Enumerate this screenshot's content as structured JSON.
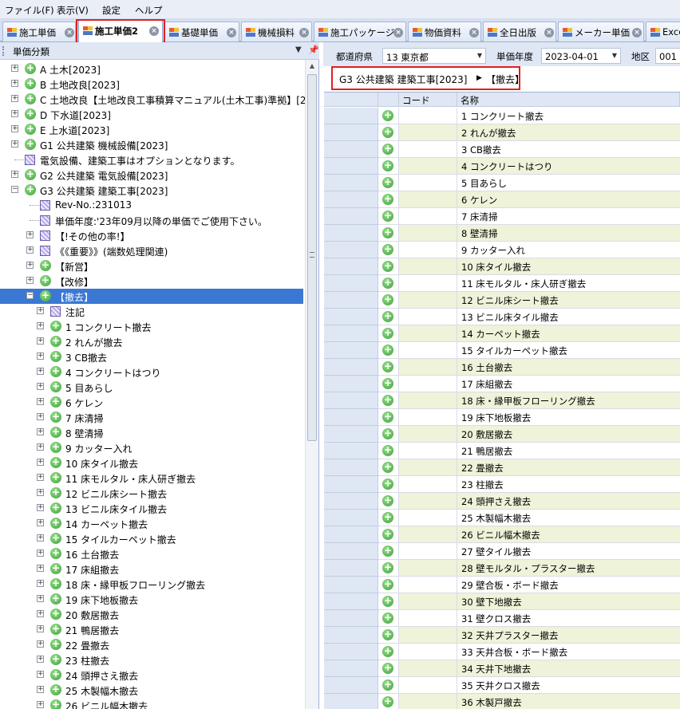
{
  "menubar": {
    "items": [
      "ファイル(F)",
      "表示(V)",
      "設定",
      "ヘルプ"
    ]
  },
  "tabs": [
    {
      "label": "施工単価",
      "active": false
    },
    {
      "label": "施工単価2",
      "active": true
    },
    {
      "label": "基礎単価",
      "active": false
    },
    {
      "label": "機械損料",
      "active": false
    },
    {
      "label": "施工パッケージ",
      "active": false
    },
    {
      "label": "物価資料",
      "active": false
    },
    {
      "label": "全日出版",
      "active": false
    },
    {
      "label": "メーカー単価",
      "active": false
    },
    {
      "label": "Exce",
      "active": false
    }
  ],
  "left_panel": {
    "title": "単価分類",
    "menu_glyph": "▼",
    "pin_glyph": "ㅁ",
    "tree": [
      {
        "label": "A 土木[2023]",
        "icon": "plus-circle-icon",
        "level": 0,
        "expander": "+"
      },
      {
        "label": "B 土地改良[2023]",
        "icon": "plus-circle-icon",
        "level": 0,
        "expander": "+"
      },
      {
        "label": "C 土地改良【土地改良工事積算マニュアル(土木工事)準拠】[2",
        "icon": "plus-circle-icon",
        "level": 0,
        "expander": "+"
      },
      {
        "label": "D 下水道[2023]",
        "icon": "plus-circle-icon",
        "level": 0,
        "expander": "+"
      },
      {
        "label": "E 上水道[2023]",
        "icon": "plus-circle-icon",
        "level": 0,
        "expander": "+"
      },
      {
        "label": "G1 公共建築 機械設備[2023]",
        "icon": "plus-circle-icon",
        "level": 0,
        "expander": "+"
      },
      {
        "label": "電気設備、建築工事はオプションとなります。",
        "icon": "note-icon",
        "level": 0,
        "expander": ""
      },
      {
        "label": "G2 公共建築 電気設備[2023]",
        "icon": "plus-circle-icon",
        "level": 0,
        "expander": "+"
      },
      {
        "label": "G3 公共建築 建築工事[2023]",
        "icon": "plus-circle-icon",
        "level": 0,
        "expander": "−"
      },
      {
        "label": "Rev-No.:231013",
        "icon": "note-icon",
        "level": 1,
        "expander": ""
      },
      {
        "label": "単価年度:'23年09月以降の単価でご使用下さい。",
        "icon": "note-icon",
        "level": 1,
        "expander": ""
      },
      {
        "label": "【!その他の率!】",
        "icon": "note-icon",
        "level": 1,
        "expander": "+"
      },
      {
        "label": "《《重要》》(端数処理関連)",
        "icon": "note-icon",
        "level": 1,
        "expander": "+"
      },
      {
        "label": "【新営】",
        "icon": "plus-circle-icon",
        "level": 1,
        "expander": "+"
      },
      {
        "label": "【改修】",
        "icon": "plus-circle-icon",
        "level": 1,
        "expander": "+"
      },
      {
        "label": "【撤去】",
        "icon": "plus-circle-icon",
        "level": 1,
        "expander": "−",
        "selected": true
      },
      {
        "label": "注記",
        "icon": "note-icon",
        "level": 2,
        "expander": "+"
      },
      {
        "label": "1 コンクリート撤去",
        "icon": "plus-circle-icon",
        "level": 2,
        "expander": "+"
      },
      {
        "label": "2 れんが撤去",
        "icon": "plus-circle-icon",
        "level": 2,
        "expander": "+"
      },
      {
        "label": "3 CB撤去",
        "icon": "plus-circle-icon",
        "level": 2,
        "expander": "+"
      },
      {
        "label": "4 コンクリートはつり",
        "icon": "plus-circle-icon",
        "level": 2,
        "expander": "+"
      },
      {
        "label": "5 目あらし",
        "icon": "plus-circle-icon",
        "level": 2,
        "expander": "+"
      },
      {
        "label": "6 ケレン",
        "icon": "plus-circle-icon",
        "level": 2,
        "expander": "+"
      },
      {
        "label": "7 床清掃",
        "icon": "plus-circle-icon",
        "level": 2,
        "expander": "+"
      },
      {
        "label": "8 壁清掃",
        "icon": "plus-circle-icon",
        "level": 2,
        "expander": "+"
      },
      {
        "label": "9 カッター入れ",
        "icon": "plus-circle-icon",
        "level": 2,
        "expander": "+"
      },
      {
        "label": "10 床タイル撤去",
        "icon": "plus-circle-icon",
        "level": 2,
        "expander": "+"
      },
      {
        "label": "11 床モルタル・床人研ぎ撤去",
        "icon": "plus-circle-icon",
        "level": 2,
        "expander": "+"
      },
      {
        "label": "12 ビニル床シート撤去",
        "icon": "plus-circle-icon",
        "level": 2,
        "expander": "+"
      },
      {
        "label": "13 ビニル床タイル撤去",
        "icon": "plus-circle-icon",
        "level": 2,
        "expander": "+"
      },
      {
        "label": "14 カーペット撤去",
        "icon": "plus-circle-icon",
        "level": 2,
        "expander": "+"
      },
      {
        "label": "15 タイルカーペット撤去",
        "icon": "plus-circle-icon",
        "level": 2,
        "expander": "+"
      },
      {
        "label": "16 土台撤去",
        "icon": "plus-circle-icon",
        "level": 2,
        "expander": "+"
      },
      {
        "label": "17 床組撤去",
        "icon": "plus-circle-icon",
        "level": 2,
        "expander": "+"
      },
      {
        "label": "18 床・縁甲板フローリング撤去",
        "icon": "plus-circle-icon",
        "level": 2,
        "expander": "+"
      },
      {
        "label": "19 床下地板撤去",
        "icon": "plus-circle-icon",
        "level": 2,
        "expander": "+"
      },
      {
        "label": "20 敷居撤去",
        "icon": "plus-circle-icon",
        "level": 2,
        "expander": "+"
      },
      {
        "label": "21 鴨居撤去",
        "icon": "plus-circle-icon",
        "level": 2,
        "expander": "+"
      },
      {
        "label": "22 畳撤去",
        "icon": "plus-circle-icon",
        "level": 2,
        "expander": "+"
      },
      {
        "label": "23 柱撤去",
        "icon": "plus-circle-icon",
        "level": 2,
        "expander": "+"
      },
      {
        "label": "24 頭押さえ撤去",
        "icon": "plus-circle-icon",
        "level": 2,
        "expander": "+"
      },
      {
        "label": "25 木製幅木撤去",
        "icon": "plus-circle-icon",
        "level": 2,
        "expander": "+"
      },
      {
        "label": "26 ビニル幅木撤去",
        "icon": "plus-circle-icon",
        "level": 2,
        "expander": "+"
      }
    ]
  },
  "filters": {
    "prefecture_label": "都道府県",
    "prefecture_value": "13 東京都",
    "year_label": "単価年度",
    "year_value": "2023-04-01",
    "region_label": "地区",
    "region_value": "001"
  },
  "breadcrumb": {
    "path": "G3 公共建築 建築工事[2023]",
    "separator": "▶",
    "current": "【撤去】"
  },
  "grid": {
    "columns": [
      "コード",
      "名称"
    ],
    "rows": [
      "1 コンクリート撤去",
      "2 れんが撤去",
      "3 CB撤去",
      "4 コンクリートはつり",
      "5 目あらし",
      "6 ケレン",
      "7 床清掃",
      "8 壁清掃",
      "9 カッター入れ",
      "10 床タイル撤去",
      "11 床モルタル・床人研ぎ撤去",
      "12 ビニル床シート撤去",
      "13 ビニル床タイル撤去",
      "14 カーペット撤去",
      "15 タイルカーペット撤去",
      "16 土台撤去",
      "17 床組撤去",
      "18 床・縁甲板フローリング撤去",
      "19 床下地板撤去",
      "20 敷居撤去",
      "21 鴨居撤去",
      "22 畳撤去",
      "23 柱撤去",
      "24 頭押さえ撤去",
      "25 木製幅木撤去",
      "26 ビニル幅木撤去",
      "27 壁タイル撤去",
      "28 壁モルタル・プラスター撤去",
      "29 壁合板・ボード撤去",
      "30 壁下地撤去",
      "31 壁クロス撤去",
      "32 天井プラスター撤去",
      "33 天井合板・ボード撤去",
      "34 天井下地撤去",
      "35 天井クロス撤去",
      "36 木製戸撤去"
    ]
  },
  "colors": {
    "selection": "#3a78d4",
    "highlight": "#e02020",
    "row_alt": "#eef3d9"
  }
}
